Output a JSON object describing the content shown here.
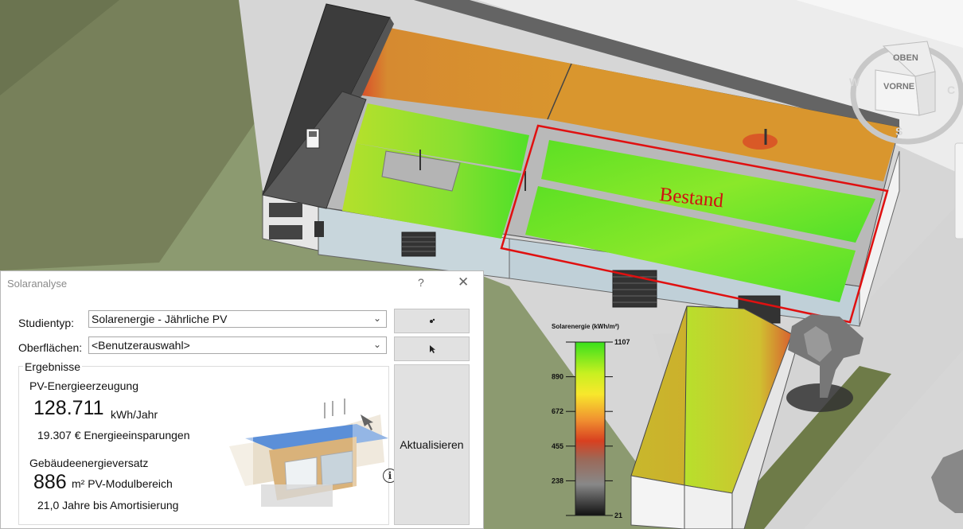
{
  "scene": {
    "annotation": "Bestand",
    "navcube": {
      "top": "OBEN",
      "front": "VORNE",
      "west": "W",
      "south": "S"
    }
  },
  "legend": {
    "title": "Solarenergie (kWh/m²)",
    "ticks": [
      "1107",
      "890",
      "672",
      "455",
      "238",
      "21"
    ],
    "colors": [
      "#39e01c",
      "#c8f020",
      "#f8e82c",
      "#f09030",
      "#d84020",
      "#9a6a5a",
      "#888888",
      "#111111"
    ]
  },
  "dialog": {
    "title": "Solaranalyse",
    "help": "?",
    "close": "✕",
    "study_label": "Studientyp:",
    "study_value": "Solarenergie - Jährliche PV",
    "surfaces_label": "Oberflächen:",
    "surfaces_value": "<Benutzerauswahl>",
    "results_group": "Ergebnisse",
    "pv_label": "PV-Energieerzeugung",
    "pv_value": "128.711",
    "pv_unit": "kWh/Jahr",
    "savings": "19.307 € Energieeinsparungen",
    "replace_label": "Gebäudeenergieversatz",
    "area_value": "886",
    "area_unit": "m² PV-Modulbereich",
    "payback": "21,0 Jahre bis Amortisierung",
    "update_button": "Aktualisieren",
    "info": "i"
  }
}
